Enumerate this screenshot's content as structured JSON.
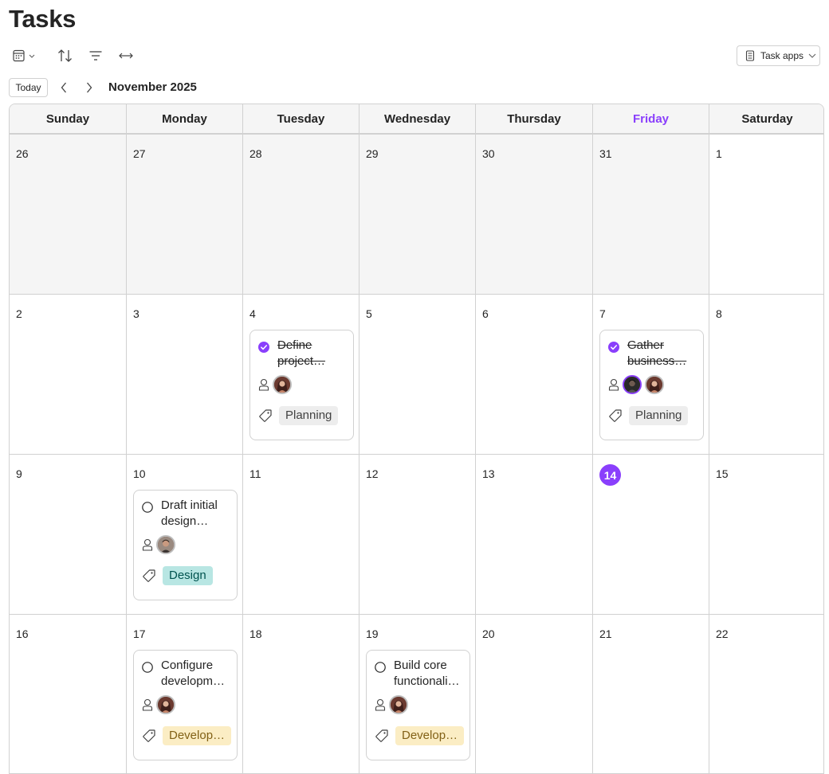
{
  "title": "Tasks",
  "toolbar": {
    "icons": [
      "calendar-view-icon",
      "sort-icon",
      "filter-icon",
      "expand-width-icon"
    ],
    "task_apps_label": "Task apps"
  },
  "nav": {
    "today_label": "Today",
    "month_label": "November 2025"
  },
  "weekdays": [
    "Sunday",
    "Monday",
    "Tuesday",
    "Wednesday",
    "Thursday",
    "Friday",
    "Saturday"
  ],
  "current_weekday_index": 5,
  "weeks": [
    {
      "days": [
        {
          "num": "26",
          "out": true
        },
        {
          "num": "27",
          "out": true
        },
        {
          "num": "28",
          "out": true
        },
        {
          "num": "29",
          "out": true
        },
        {
          "num": "30",
          "out": true
        },
        {
          "num": "31",
          "out": true
        },
        {
          "num": "1",
          "out": false
        }
      ]
    },
    {
      "days": [
        {
          "num": "2"
        },
        {
          "num": "3"
        },
        {
          "num": "4",
          "task": {
            "title": "Define project…",
            "done": true,
            "avatars": [
              "woman-avatar"
            ],
            "label": "Planning",
            "label_color": "gray"
          }
        },
        {
          "num": "5"
        },
        {
          "num": "6"
        },
        {
          "num": "7",
          "task": {
            "title": "Gather business…",
            "done": true,
            "avatars": [
              "dark-avatar",
              "woman-avatar"
            ],
            "label": "Planning",
            "label_color": "gray"
          }
        },
        {
          "num": "8"
        }
      ]
    },
    {
      "days": [
        {
          "num": "9"
        },
        {
          "num": "10",
          "task": {
            "title": "Draft initial design…",
            "done": false,
            "avatars": [
              "man-avatar"
            ],
            "label": "Design",
            "label_color": "teal"
          }
        },
        {
          "num": "11"
        },
        {
          "num": "12"
        },
        {
          "num": "13"
        },
        {
          "num": "14",
          "today": true
        },
        {
          "num": "15"
        }
      ]
    },
    {
      "days": [
        {
          "num": "16"
        },
        {
          "num": "17",
          "task": {
            "title": "Configure developm…",
            "done": false,
            "avatars": [
              "woman-avatar"
            ],
            "label": "Develop…",
            "label_color": "yellow"
          }
        },
        {
          "num": "18"
        },
        {
          "num": "19",
          "task": {
            "title": "Build core functionali…",
            "done": false,
            "avatars": [
              "woman-avatar"
            ],
            "label": "Develop…",
            "label_color": "yellow"
          }
        },
        {
          "num": "20"
        },
        {
          "num": "21"
        },
        {
          "num": "22"
        }
      ]
    }
  ],
  "colors": {
    "accent": "#8a3ffc",
    "grid_line": "#d1d1d1",
    "out_of_month_bg": "#f5f5f5",
    "label_gray_bg": "#ededed",
    "label_gray_fg": "#424242",
    "label_teal_bg": "#b8e6e3",
    "label_teal_fg": "#00534f",
    "label_yellow_bg": "#fbedc4",
    "label_yellow_fg": "#826116"
  }
}
